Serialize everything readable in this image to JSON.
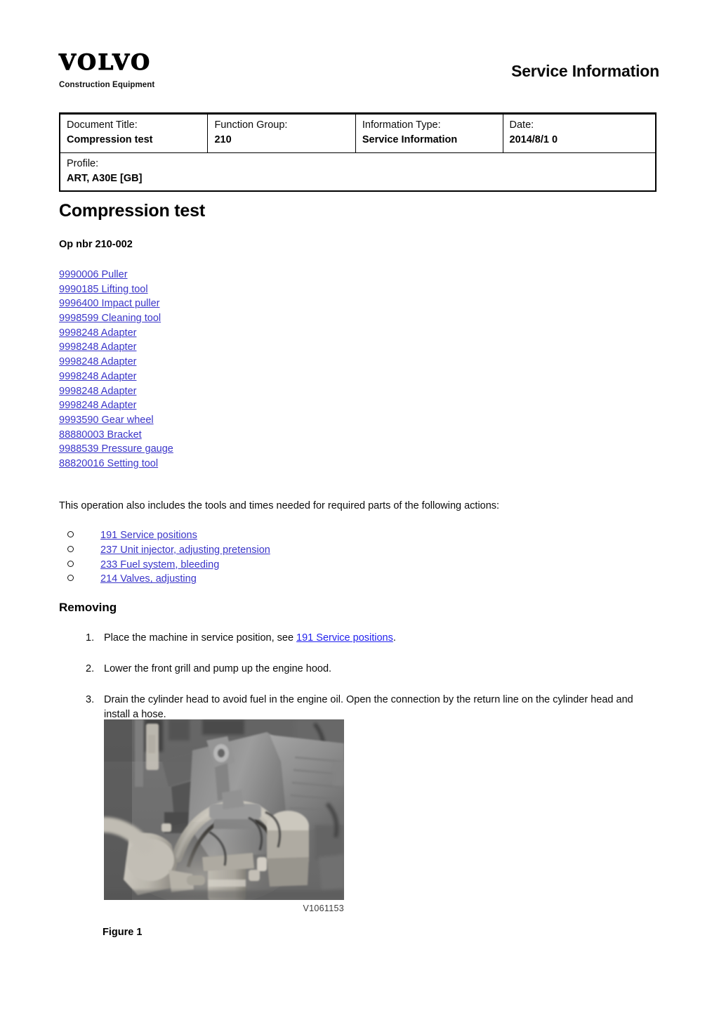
{
  "header": {
    "logo_word": "VOLVO",
    "logo_sub": "Construction Equipment",
    "title": "Service Information"
  },
  "info_table": {
    "rows": [
      {
        "cells": [
          {
            "label": "Document Title:",
            "value": "Compression test"
          },
          {
            "label": "Function Group:",
            "value": "210"
          },
          {
            "label": "Information Type:",
            "value": "Service Information"
          },
          {
            "label": "Date:",
            "value": "2014/8/1 0"
          }
        ]
      },
      {
        "cells": [
          {
            "label": "Profile:",
            "value": "ART, A30E [GB]"
          }
        ]
      }
    ]
  },
  "document": {
    "title": "Compression test",
    "op_nbr": "Op nbr 210-002",
    "tools": [
      "9990006 Puller",
      "9990185 Lifting tool",
      "9996400 Impact puller",
      "9998599 Cleaning tool",
      "9998248 Adapter",
      "9998248 Adapter",
      "9998248 Adapter",
      "9998248 Adapter",
      "9998248 Adapter",
      "9998248 Adapter",
      "9993590 Gear wheel",
      "88880003 Bracket",
      "9988539 Pressure gauge",
      "88820016 Setting tool"
    ],
    "intro_line": "This operation also includes the tools and times needed for required parts of the following actions:",
    "actions": [
      "191 Service positions",
      "237 Unit injector, adjusting pretension",
      "233 Fuel system, bleeding",
      "214 Valves, adjusting"
    ],
    "section_heading": "Removing",
    "steps": [
      {
        "num": "1.",
        "text_before": "Place the machine in service position, see ",
        "link": "191 Service positions",
        "text_after": "."
      },
      {
        "num": "2.",
        "text_before": "Lower the front grill and pump up the engine hood.",
        "link": "",
        "text_after": ""
      },
      {
        "num": "3.",
        "text_before": "Drain the cylinder head to avoid fuel in the engine oil. Open the connection by the return line on the cylinder head and install a hose.",
        "link": "",
        "text_after": ""
      }
    ],
    "figure": {
      "image_code": "V1061153",
      "caption": "Figure 1",
      "alt": "grayscale photo of a diesel engine bay with a return line hose installed"
    }
  },
  "colors": {
    "link": "#3a35c9",
    "step_link": "#2222ee",
    "text": "#0b0b0b",
    "border": "#000000"
  }
}
